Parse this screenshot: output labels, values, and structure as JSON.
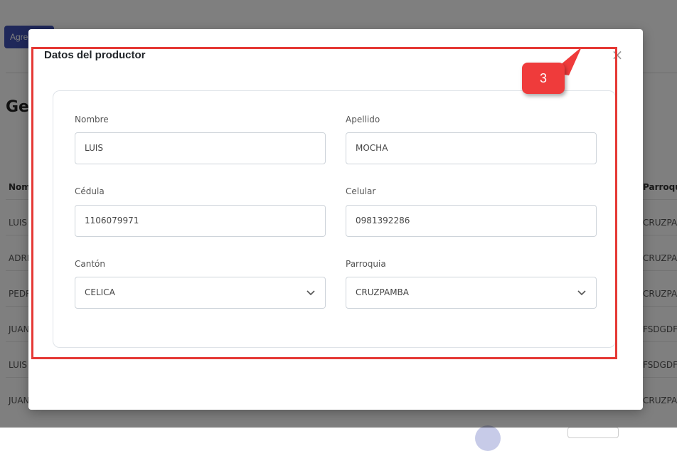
{
  "background": {
    "add_button_label": "Agregar",
    "section_title": "Gestión",
    "columns": {
      "nombre": "Nombre",
      "parroquia": "Parroquia"
    },
    "rows": [
      {
        "nombre": "LUIS",
        "parroquia": "CRUZPAMBA"
      },
      {
        "nombre": "ADRIAN",
        "parroquia": "CRUZPAMBA"
      },
      {
        "nombre": "PEDRO",
        "parroquia": "CRUZPAMBA"
      },
      {
        "nombre": "JUAN",
        "parroquia": "FSDGDF"
      },
      {
        "nombre": "LUIS",
        "parroquia": "FSDGDF"
      },
      {
        "nombre": "JUAN",
        "parroquia": "CRUZPAMBA"
      }
    ]
  },
  "modal": {
    "title": "Datos del productor",
    "close_icon": "close-icon",
    "fields": {
      "nombre": {
        "label": "Nombre",
        "value": "LUIS"
      },
      "apellido": {
        "label": "Apellido",
        "value": "MOCHA"
      },
      "cedula": {
        "label": "Cédula",
        "value": "1106079971"
      },
      "celular": {
        "label": "Celular",
        "value": "0981392286"
      },
      "canton": {
        "label": "Cantón",
        "value": "CELICA"
      },
      "parroquia": {
        "label": "Parroquia",
        "value": "CRUZPAMBA"
      }
    }
  },
  "annotation": {
    "step_number": "3",
    "color": "#e53935"
  },
  "colors": {
    "accent": "#3f51b5",
    "annotation": "#ef3b3b"
  }
}
